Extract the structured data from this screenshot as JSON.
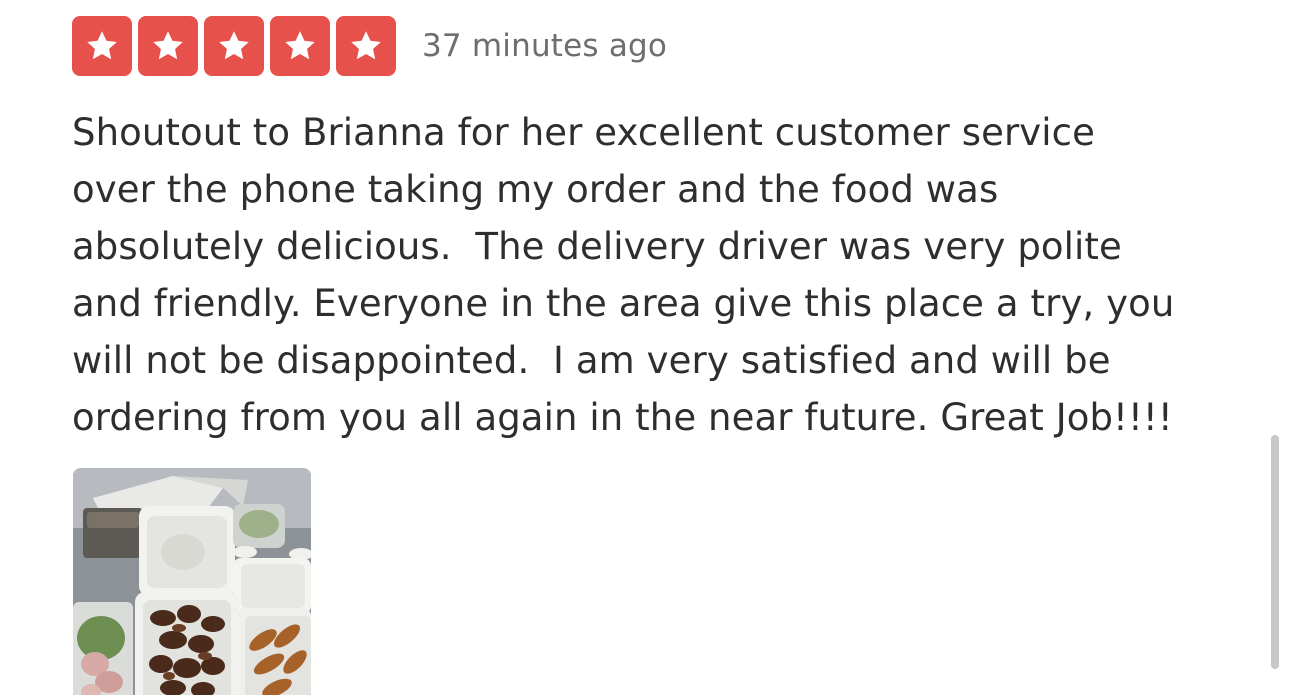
{
  "review": {
    "rating": 5,
    "max_rating": 5,
    "star_color": "#e6524b",
    "star_icon": "star-icon",
    "timestamp": "37 minutes ago",
    "lines": [
      "Shoutout to Brianna for her excellent customer service",
      "over the phone taking my order and the food was",
      "absolutely delicious.  The delivery driver was very polite",
      "and friendly. Everyone in the area give this place a try, you",
      "will not be disappointed.  I am very satisfied and will be",
      "ordering from you all again in the near future. Great Job!!!!"
    ]
  },
  "photo": {
    "subject": "food-photo"
  }
}
